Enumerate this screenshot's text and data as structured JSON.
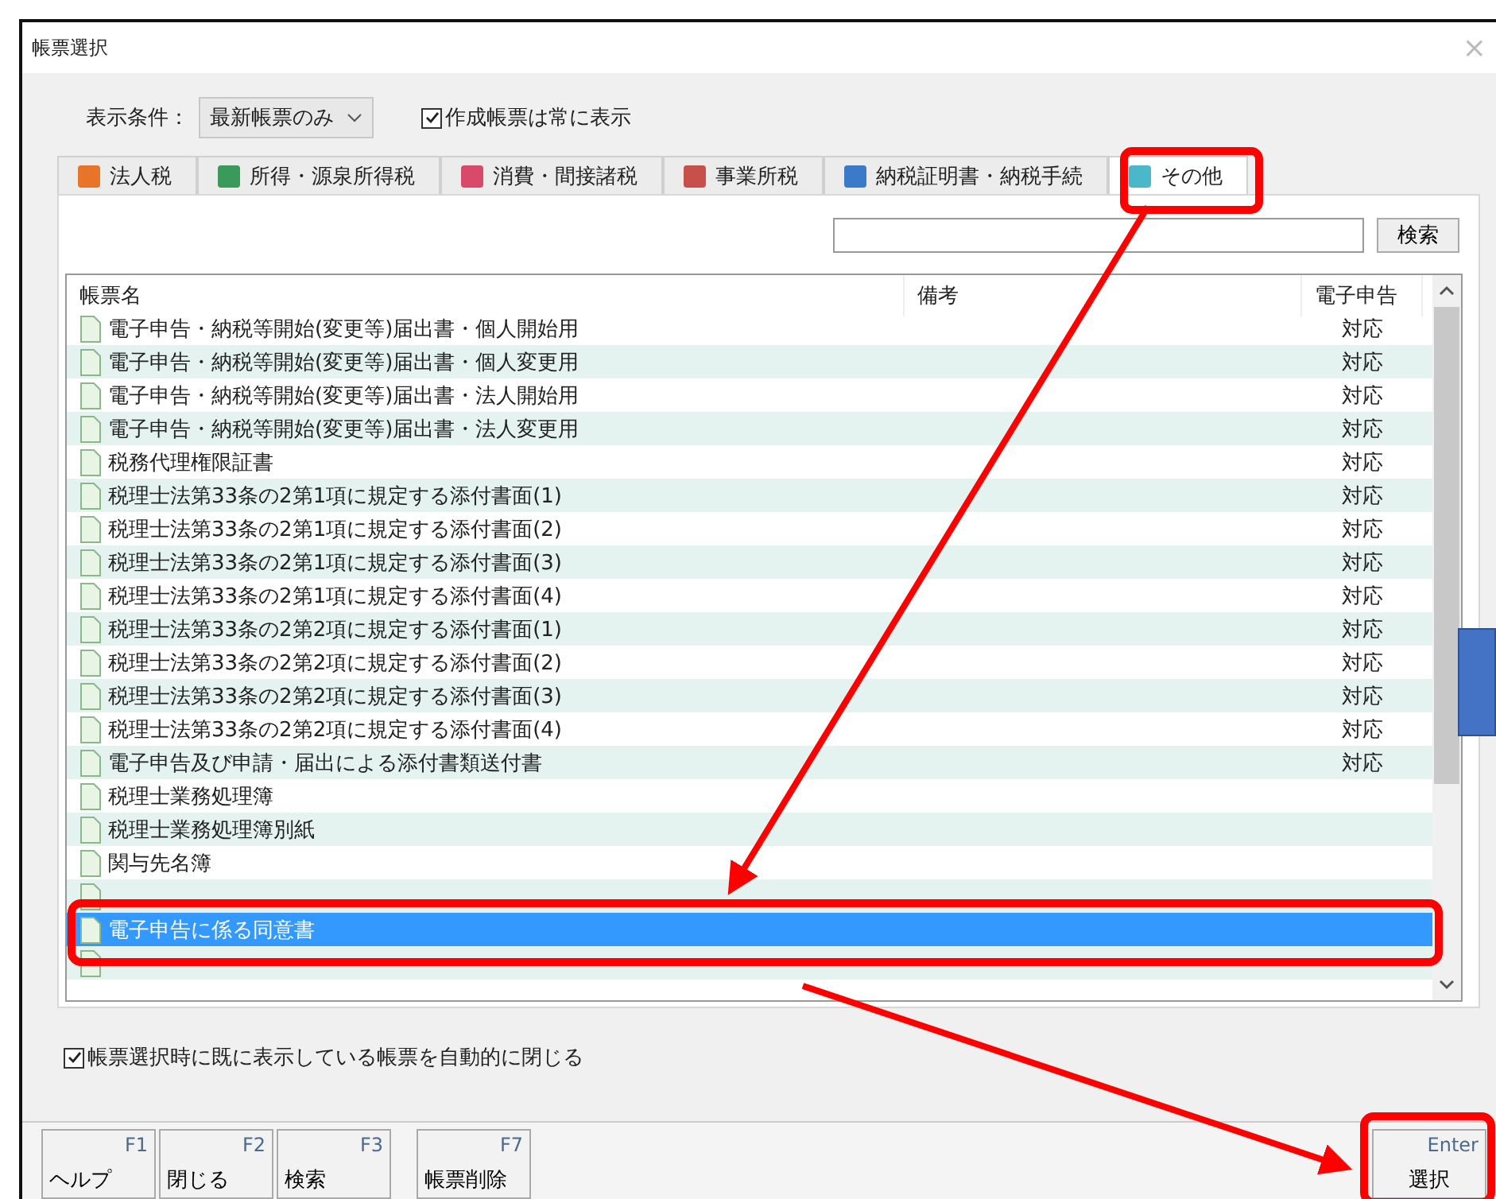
{
  "window": {
    "title": "帳票選択",
    "close": "×"
  },
  "filter": {
    "label": "表示条件：",
    "value": "最新帳票のみ",
    "checkbox": {
      "label": "作成帳票は常に表示",
      "checked": true
    }
  },
  "tabs": [
    {
      "label": "法人税",
      "selected": false,
      "color": "#e8742a"
    },
    {
      "label": "所得・源泉所得税",
      "selected": false,
      "color": "#3a9a5a"
    },
    {
      "label": "消費・間接諸税",
      "selected": false,
      "color": "#d94a6a"
    },
    {
      "label": "事業所税",
      "selected": false,
      "color": "#c8504a"
    },
    {
      "label": "納税証明書・納税手続",
      "selected": false,
      "color": "#3a7ac8"
    },
    {
      "label": "その他",
      "selected": true,
      "color": "#4ab8c8"
    }
  ],
  "search": {
    "button": "検索"
  },
  "table": {
    "columns": [
      "帳票名",
      "備考",
      "電子申告"
    ],
    "rows": [
      {
        "name": "電子申告・納税等開始(変更等)届出書・個人開始用",
        "note": "",
        "efile": "対応",
        "selected": false
      },
      {
        "name": "電子申告・納税等開始(変更等)届出書・個人変更用",
        "note": "",
        "efile": "対応",
        "selected": false
      },
      {
        "name": "電子申告・納税等開始(変更等)届出書・法人開始用",
        "note": "",
        "efile": "対応",
        "selected": false
      },
      {
        "name": "電子申告・納税等開始(変更等)届出書・法人変更用",
        "note": "",
        "efile": "対応",
        "selected": false
      },
      {
        "name": "税務代理権限証書",
        "note": "",
        "efile": "対応",
        "selected": false
      },
      {
        "name": "税理士法第33条の2第1項に規定する添付書面(1)",
        "note": "",
        "efile": "対応",
        "selected": false
      },
      {
        "name": "税理士法第33条の2第1項に規定する添付書面(2)",
        "note": "",
        "efile": "対応",
        "selected": false
      },
      {
        "name": "税理士法第33条の2第1項に規定する添付書面(3)",
        "note": "",
        "efile": "対応",
        "selected": false
      },
      {
        "name": "税理士法第33条の2第1項に規定する添付書面(4)",
        "note": "",
        "efile": "対応",
        "selected": false
      },
      {
        "name": "税理士法第33条の2第2項に規定する添付書面(1)",
        "note": "",
        "efile": "対応",
        "selected": false
      },
      {
        "name": "税理士法第33条の2第2項に規定する添付書面(2)",
        "note": "",
        "efile": "対応",
        "selected": false
      },
      {
        "name": "税理士法第33条の2第2項に規定する添付書面(3)",
        "note": "",
        "efile": "対応",
        "selected": false
      },
      {
        "name": "税理士法第33条の2第2項に規定する添付書面(4)",
        "note": "",
        "efile": "対応",
        "selected": false
      },
      {
        "name": "電子申告及び申請・届出による添付書類送付書",
        "note": "",
        "efile": "対応",
        "selected": false
      },
      {
        "name": "税理士業務処理簿",
        "note": "",
        "efile": "",
        "selected": false
      },
      {
        "name": "税理士業務処理簿別紙",
        "note": "",
        "efile": "",
        "selected": false
      },
      {
        "name": "関与先名簿",
        "note": "",
        "efile": "",
        "selected": false
      },
      {
        "selected": false
      },
      {
        "name": "電子申告に係る同意書",
        "note": "",
        "efile": "",
        "selected": true
      },
      {
        "selected": false
      }
    ]
  },
  "auto_close": {
    "label": "帳票選択時に既に表示している帳票を自動的に閉じる",
    "checked": true
  },
  "function_keys": [
    {
      "key": "F1",
      "label": "ヘルプ"
    },
    {
      "key": "F2",
      "label": "閉じる"
    },
    {
      "key": "F3",
      "label": "検索"
    },
    {
      "key": "F7",
      "label": "帳票削除"
    },
    {
      "key": "Enter",
      "label": "選択"
    }
  ]
}
